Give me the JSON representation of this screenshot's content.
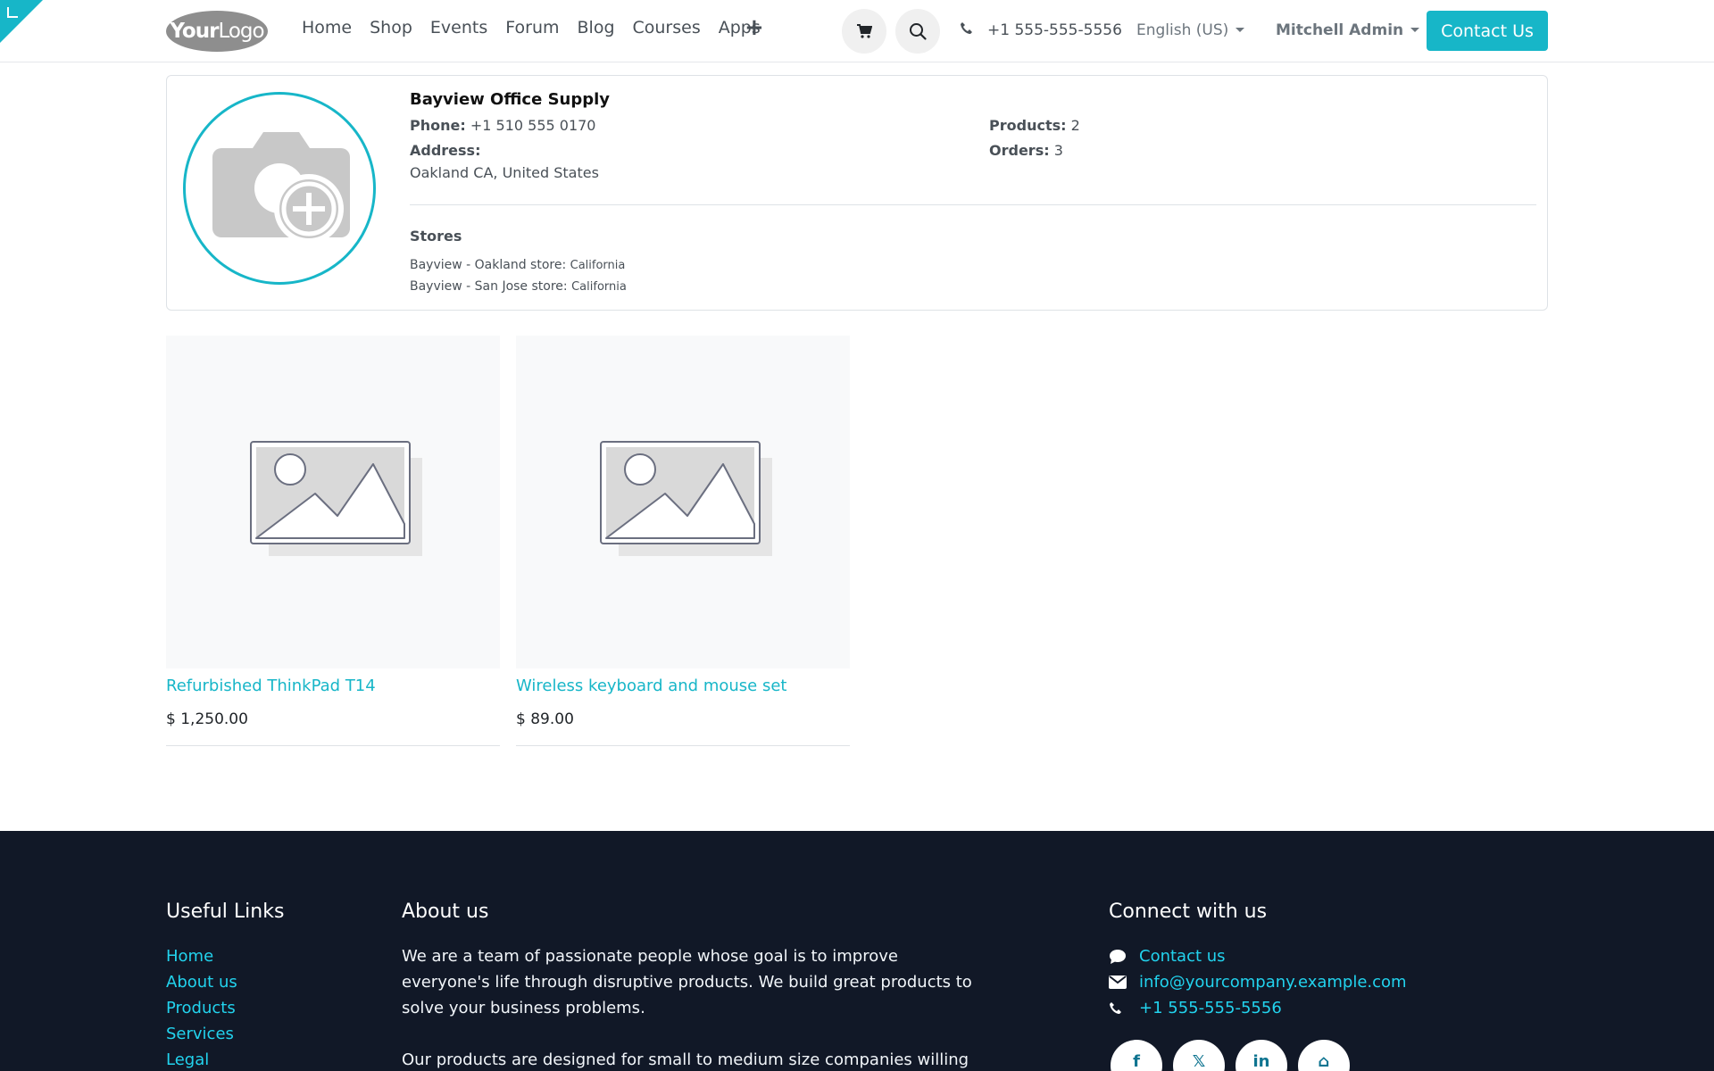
{
  "header": {
    "logo": {
      "bold": "Your",
      "light": "Logo"
    },
    "nav": [
      "Home",
      "Shop",
      "Events",
      "Forum",
      "Blog",
      "Courses",
      "Apps"
    ],
    "plus": "+",
    "phone": "+1 555-555-5556",
    "language": "English (US)",
    "user": "Mitchell Admin",
    "contact_button": "Contact Us"
  },
  "seller": {
    "name": "Bayview Office Supply",
    "phone_label": "Phone:",
    "phone_value": "+1 510 555 0170",
    "address_label": "Address:",
    "address_value": "Oakland CA, United States",
    "products_label": "Products:",
    "products_value": "2",
    "orders_label": "Orders:",
    "orders_value": "3",
    "stores_title": "Stores",
    "stores": [
      {
        "name": "Bayview - Oakland store:",
        "region": "California"
      },
      {
        "name": "Bayview - San Jose store:",
        "region": "California"
      }
    ]
  },
  "products": [
    {
      "name": "Refurbished ThinkPad T14",
      "price": "$ 1,250.00"
    },
    {
      "name": "Wireless keyboard and mouse set",
      "price": "$ 89.00"
    }
  ],
  "footer": {
    "links_title": "Useful Links",
    "links": [
      "Home",
      "About us",
      "Products",
      "Services",
      "Legal"
    ],
    "about_title": "About us",
    "about_p1": "We are a team of passionate people whose goal is to improve everyone's life through disruptive products. We build great products to solve your business problems.",
    "about_p2": "Our products are designed for small to medium size companies willing",
    "connect_title": "Connect with us",
    "connect": {
      "contact": "Contact us",
      "email": "info@yourcompany.example.com",
      "phone": "+1 555-555-5556"
    },
    "socials": [
      {
        "icon": "facebook-icon",
        "glyph": "f"
      },
      {
        "icon": "x-twitter-icon",
        "glyph": "𝕏"
      },
      {
        "icon": "linkedin-icon",
        "glyph": "in"
      },
      {
        "icon": "home-icon",
        "glyph": "⌂"
      }
    ]
  },
  "colors": {
    "accent": "#17b6c8",
    "footer_bg": "#111827",
    "footer_link": "#22d3ee"
  }
}
